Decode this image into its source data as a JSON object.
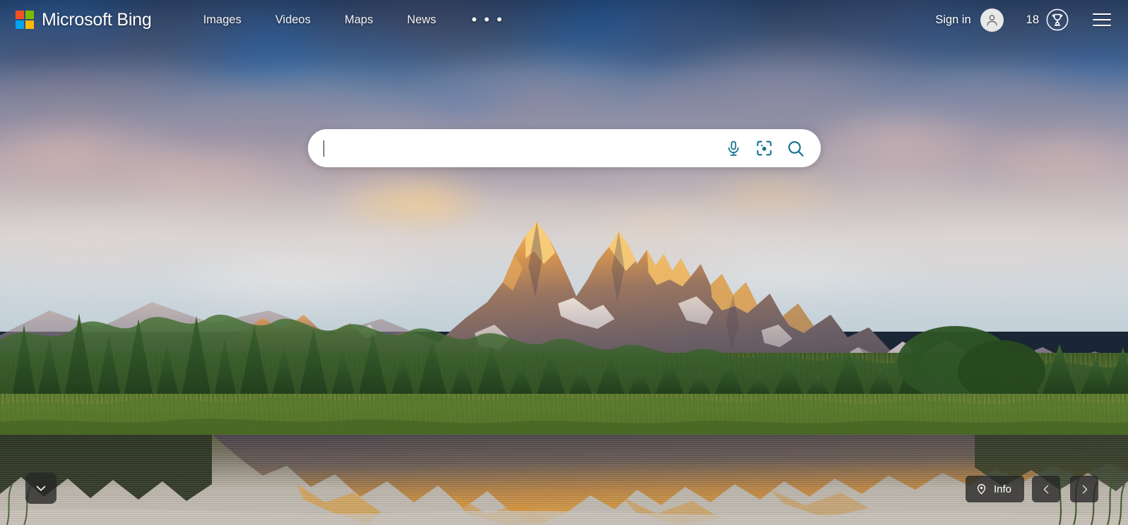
{
  "header": {
    "brand": "Microsoft Bing",
    "logo_icon": "microsoft-squares-logo",
    "logo_colors": {
      "top_left": "#f25022",
      "top_right": "#7fba00",
      "bottom_left": "#00a4ef",
      "bottom_right": "#ffb900"
    },
    "nav": [
      {
        "label": "Images",
        "name": "nav-images"
      },
      {
        "label": "Videos",
        "name": "nav-videos"
      },
      {
        "label": "Maps",
        "name": "nav-maps"
      },
      {
        "label": "News",
        "name": "nav-news"
      }
    ],
    "more_label": "• • •",
    "more_icon": "ellipsis-icon",
    "sign_in_label": "Sign in",
    "avatar_icon": "person-avatar-icon",
    "rewards_count": "18",
    "rewards_icon": "rewards-medal-icon",
    "menu_icon": "hamburger-menu-icon"
  },
  "search": {
    "value": "",
    "placeholder": "",
    "mic_icon": "microphone-icon",
    "visual_search_icon": "visual-search-camera-icon",
    "submit_icon": "search-magnifier-icon",
    "icon_color": "#12708f"
  },
  "bottom": {
    "scroll_down_icon": "chevron-down-icon",
    "info_label": "Info",
    "info_icon": "location-pin-icon",
    "prev_icon": "chevron-left-icon",
    "next_icon": "chevron-right-icon"
  },
  "background": {
    "description": "Grand Teton mountain range at sunrise with alpenglow, evergreen forest, green meadow and mirror reflection in still water",
    "sky_colors": [
      "#2a4a74",
      "#5878a0",
      "#b0a8b4",
      "#d8d4d2"
    ],
    "peak_glow_color": "#f0a848",
    "meadow_color": "#6b8834",
    "water_color": "#cfc8bd"
  }
}
